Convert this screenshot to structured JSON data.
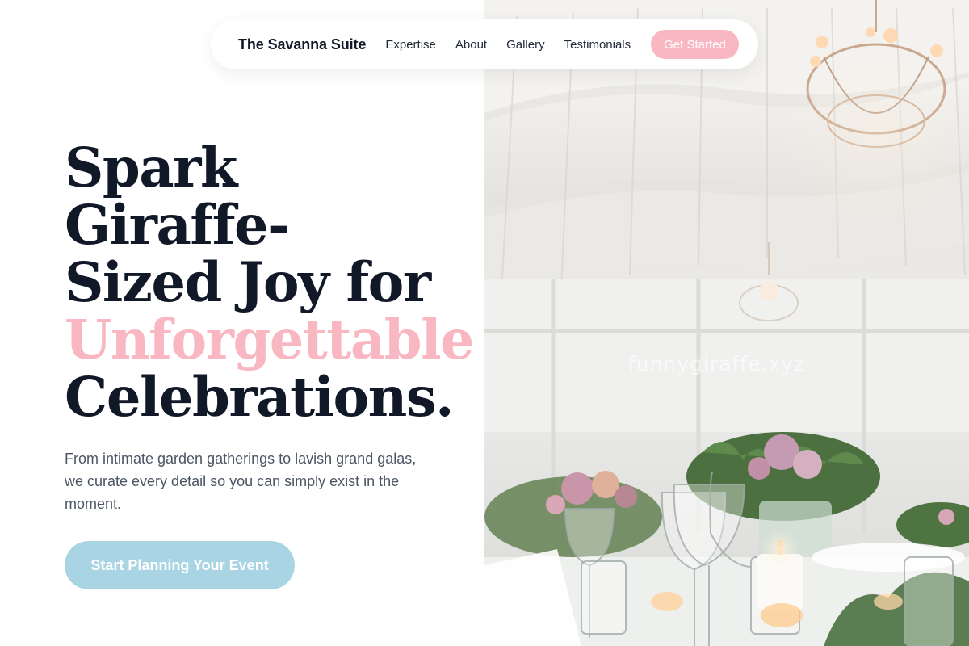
{
  "nav": {
    "brand": "The Savanna Suite",
    "links": [
      "Expertise",
      "About",
      "Gallery",
      "Testimonials"
    ],
    "cta_label": "Get Started"
  },
  "hero": {
    "headline_lines": [
      "Spark",
      "Giraffe-",
      "Sized Joy for"
    ],
    "headline_accent": "Unforgettable",
    "headline_end": "Celebrations.",
    "subtitle": "From intimate garden gatherings to lavish grand galas, we curate every detail so you can simply exist in the moment.",
    "cta_label": "Start Planning Your Event"
  },
  "photo": {
    "watermark": "funnygiraffe.xyz",
    "description_icon": "wedding-reception-photo"
  },
  "colors": {
    "accent_pink": "#f9b7c2",
    "accent_blue": "#a8d4e4",
    "text_dark": "#111827",
    "text_muted": "#4b5563"
  }
}
